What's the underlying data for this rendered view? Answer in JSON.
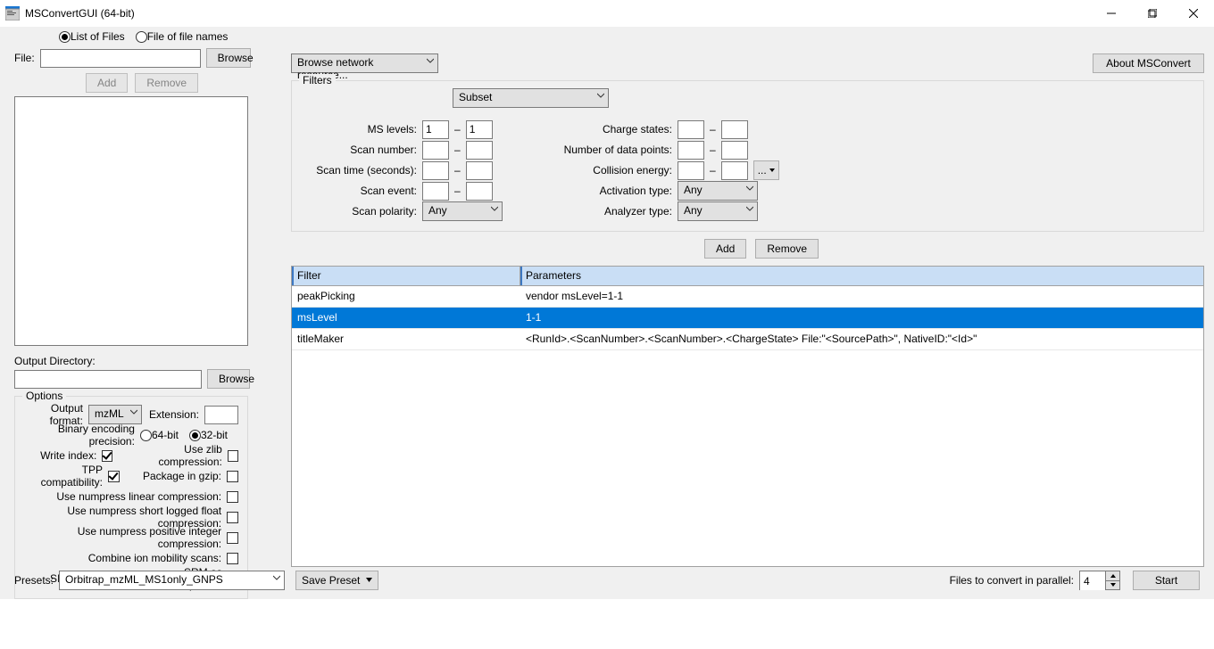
{
  "window": {
    "title": "MSConvertGUI (64-bit)"
  },
  "top": {
    "list_of_files": "List of Files",
    "file_of_names": "File of file names",
    "file_label": "File:",
    "browse": "Browse",
    "add": "Add",
    "remove": "Remove"
  },
  "net": {
    "browse_network": "Browse network resource..."
  },
  "about": {
    "label": "About MSConvert"
  },
  "out": {
    "label": "Output Directory:",
    "browse": "Browse"
  },
  "options": {
    "legend": "Options",
    "output_format": "Output format:",
    "format_value": "mzML",
    "extension": "Extension:",
    "precision": "Binary encoding precision:",
    "p64": "64-bit",
    "p32": "32-bit",
    "write_index": "Write index:",
    "zlib": "Use zlib compression:",
    "tpp": "TPP compatibility:",
    "gzip": "Package in gzip:",
    "numlin": "Use numpress linear compression:",
    "numshort": "Use numpress short logged float compression:",
    "numpos": "Use numpress positive integer compression:",
    "combine": "Combine ion mobility scans:",
    "sim": "SIM as spectra:",
    "srm": "SRM as spectra:"
  },
  "filters": {
    "legend": "Filters",
    "subset": "Subset",
    "mslevels": "MS levels:",
    "ms1": "1",
    "ms2": "1",
    "scannum": "Scan number:",
    "scantime": "Scan time (seconds):",
    "scanevent": "Scan event:",
    "scanpol": "Scan polarity:",
    "any": "Any",
    "charge": "Charge states:",
    "ndata": "Number of data points:",
    "collision": "Collision energy:",
    "activation": "Activation type:",
    "analyzer": "Analyzer type:",
    "dots": "...",
    "add": "Add",
    "remove": "Remove"
  },
  "table": {
    "h_filter": "Filter",
    "h_params": "Parameters",
    "rows": [
      {
        "filter": "peakPicking",
        "params": "vendor msLevel=1-1"
      },
      {
        "filter": "msLevel",
        "params": "1-1"
      },
      {
        "filter": "titleMaker",
        "params": "<RunId>.<ScanNumber>.<ScanNumber>.<ChargeState> File:\"<SourcePath>\", NativeID:\"<Id>\""
      }
    ]
  },
  "footer": {
    "presets": "Presets:",
    "preset_value": "Orbitrap_mzML_MS1only_GNPS",
    "save_preset": "Save Preset",
    "parallel": "Files to convert in parallel:",
    "parallel_n": "4",
    "start": "Start"
  }
}
